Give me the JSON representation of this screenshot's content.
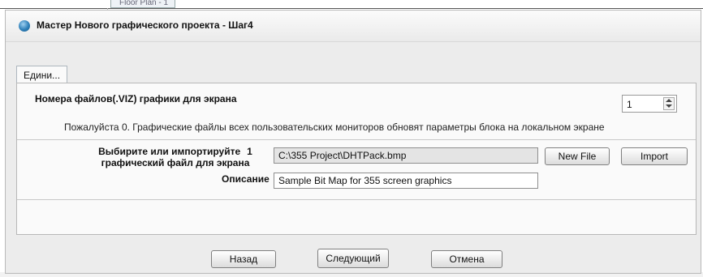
{
  "background": {
    "tab_label": "Floor Plan - 1"
  },
  "dialog": {
    "title": "Мастер Нового графического проекта - Шаг4",
    "tab_label": "Едини..."
  },
  "section": {
    "title": "Номера файлов(.VIZ) графики для экрана",
    "count_value": "1",
    "info": "Пожалуйста  0. Графические файлы всех пользовательских мониторов обновят параметры блока на локальном экране"
  },
  "file_row": {
    "label_line1": "Выбирите или импортируйте",
    "number": "1",
    "label_line2": "графический файл для  экрана",
    "path_value": "C:\\355 Project\\DHTPack.bmp",
    "new_file_label": "New File",
    "import_label": "Import",
    "description_label": "Описание",
    "description_value": "Sample Bit Map for 355 screen graphics"
  },
  "footer": {
    "back_label": "Назад",
    "next_label": "Следующий",
    "cancel_label": "Отмена"
  }
}
